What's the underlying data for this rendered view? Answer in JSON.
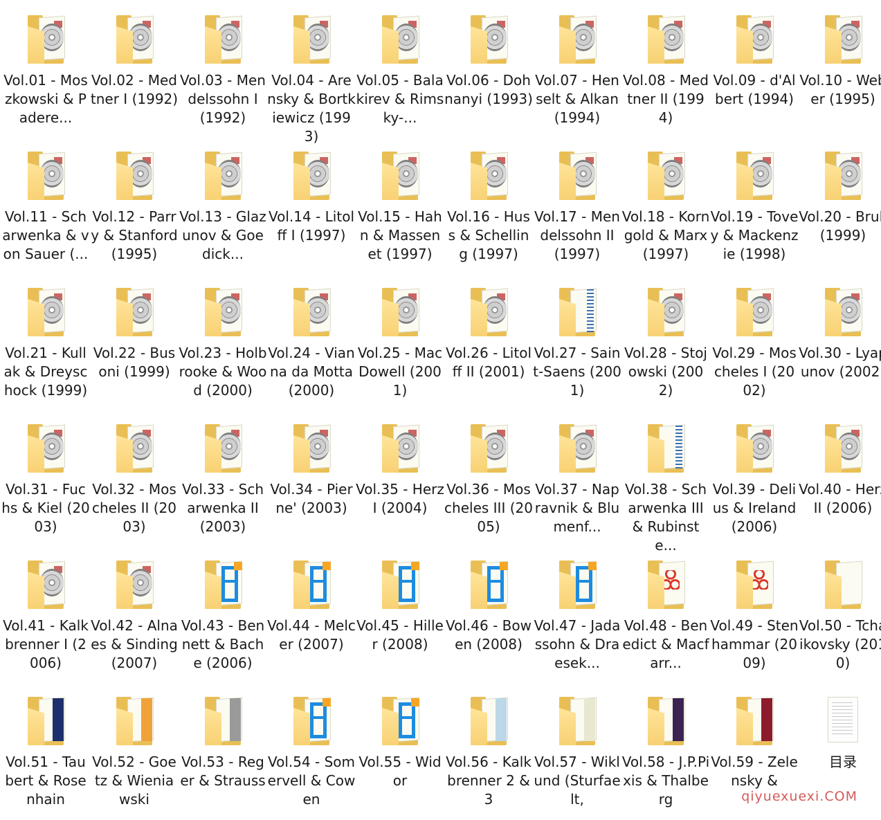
{
  "folders": [
    {
      "label": "Vol.01 - Moszkowski & Padere...",
      "icon": "cd"
    },
    {
      "label": "Vol.02 - Medtner I (1992)",
      "icon": "cd"
    },
    {
      "label": "Vol.03 - Mendelssohn I (1992)",
      "icon": "cd"
    },
    {
      "label": "Vol.04 - Arensky & Bortkiewicz (1993)",
      "icon": "cd"
    },
    {
      "label": "Vol.05 - Balakirev & Rimsky-...",
      "icon": "cd"
    },
    {
      "label": "Vol.06 - Dohnanyi (1993)",
      "icon": "cd"
    },
    {
      "label": "Vol.07 - Henselt & Alkan (1994)",
      "icon": "cd"
    },
    {
      "label": "Vol.08 - Medtner II (1994)",
      "icon": "cd"
    },
    {
      "label": "Vol.09 - d'Albert (1994)",
      "icon": "cd"
    },
    {
      "label": "Vol.10 - Weber (1995)",
      "icon": "cd"
    },
    {
      "label": "Vol.11 - Scharwenka & von Sauer (...",
      "icon": "cd"
    },
    {
      "label": "Vol.12 - Parry & Stanford (1995)",
      "icon": "cd"
    },
    {
      "label": "Vol.13 - Glazunov & Goedick...",
      "icon": "cd"
    },
    {
      "label": "Vol.14 - Litolff I (1997)",
      "icon": "cd"
    },
    {
      "label": "Vol.15 - Hahn & Massenet (1997)",
      "icon": "cd"
    },
    {
      "label": "Vol.16 - Huss & Schelling (1997)",
      "icon": "cd"
    },
    {
      "label": "Vol.17 - Mendelssohn II (1997)",
      "icon": "cd"
    },
    {
      "label": "Vol.18 - Korngold & Marx (1997)",
      "icon": "cd"
    },
    {
      "label": "Vol.19 - Tovey & Mackenzie (1998)",
      "icon": "cd"
    },
    {
      "label": "Vol.20 - Brull (1999)",
      "icon": "cd"
    },
    {
      "label": "Vol.21 - Kullak & Dreyschock (1999)",
      "icon": "cd"
    },
    {
      "label": "Vol.22 - Busoni (1999)",
      "icon": "cd"
    },
    {
      "label": "Vol.23 - Holbrooke & Wood (2000)",
      "icon": "cd"
    },
    {
      "label": "Vol.24 - Vianna da Motta (2000)",
      "icon": "cd"
    },
    {
      "label": "Vol.25 - MacDowell (2001)",
      "icon": "cd"
    },
    {
      "label": "Vol.26 - Litolff II (2001)",
      "icon": "cd"
    },
    {
      "label": "Vol.27 - Saint-Saens (2001)",
      "icon": "doc-blue"
    },
    {
      "label": "Vol.28 - Stojowski (2002)",
      "icon": "cd"
    },
    {
      "label": "Vol.29 - Moscheles I (2002)",
      "icon": "cd"
    },
    {
      "label": "Vol.30 - Lyapunov (2002)",
      "icon": "cd"
    },
    {
      "label": "Vol.31 - Fuchs & Kiel (2003)",
      "icon": "cd"
    },
    {
      "label": "Vol.32 - Moscheles II (2003)",
      "icon": "cd"
    },
    {
      "label": "Vol.33 - Scharwenka II (2003)",
      "icon": "cd"
    },
    {
      "label": "Vol.34 - Pierne' (2003)",
      "icon": "cd"
    },
    {
      "label": "Vol.35 - Herz I (2004)",
      "icon": "cd"
    },
    {
      "label": "Vol.36 - Moscheles III (2005)",
      "icon": "cd"
    },
    {
      "label": "Vol.37 - Napravnik & Blumenf...",
      "icon": "cd"
    },
    {
      "label": "Vol.38 - Scharwenka III & Rubinste...",
      "icon": "doc-green"
    },
    {
      "label": "Vol.39 - Delius & Ireland (2006)",
      "icon": "cd"
    },
    {
      "label": "Vol.40 - Herz II (2006)",
      "icon": "cd"
    },
    {
      "label": "Vol.41 - Kalkbrenner I (2006)",
      "icon": "cd"
    },
    {
      "label": "Vol.42 - Alnaes & Sinding (2007)",
      "icon": "cd"
    },
    {
      "label": "Vol.43 - Bennett & Bache (2006)",
      "icon": "blue"
    },
    {
      "label": "Vol.44 - Melcer (2007)",
      "icon": "blue"
    },
    {
      "label": "Vol.45 - Hiller (2008)",
      "icon": "blue"
    },
    {
      "label": "Vol.46 - Bowen (2008)",
      "icon": "blue-red"
    },
    {
      "label": "Vol.47 - Jadassohn & Draesek...",
      "icon": "blue-teal"
    },
    {
      "label": "Vol.48 - Benedict & Macfarr...",
      "icon": "pdf"
    },
    {
      "label": "Vol.49 - Stenhammar (2009)",
      "icon": "pdf-green"
    },
    {
      "label": "Vol.50 - Tchaikovsky (2010)",
      "icon": "plain"
    },
    {
      "label": "Vol.51 - Taubert & Rosenhain",
      "icon": "strip-navy"
    },
    {
      "label": "Vol.52 - Goetz & Wieniawski",
      "icon": "strip-orange"
    },
    {
      "label": "Vol.53 - Reger & Strauss",
      "icon": "strip-grey"
    },
    {
      "label": "Vol.54 - Somervell & Cowen",
      "icon": "blue"
    },
    {
      "label": "Vol.55 - Widor",
      "icon": "blue"
    },
    {
      "label": "Vol.56 - Kalkbrenner 2 & 3",
      "icon": "strip-light"
    },
    {
      "label": "Vol.57 - Wiklund (Sturfaelt,",
      "icon": "strip-pale"
    },
    {
      "label": "Vol.58 - J.P.Pixis & Thalberg",
      "icon": "strip-purple"
    },
    {
      "label": "Vol.59 - Zelensky &",
      "icon": "strip-maroon"
    },
    {
      "label": "目录",
      "icon": "document"
    }
  ],
  "watermark": "qiyuexuexi.COM",
  "colors": {
    "folder": "#f8d173",
    "folder_back": "#e9bf55",
    "text": "#1a1a1a",
    "watermark": "#d45a5a"
  }
}
